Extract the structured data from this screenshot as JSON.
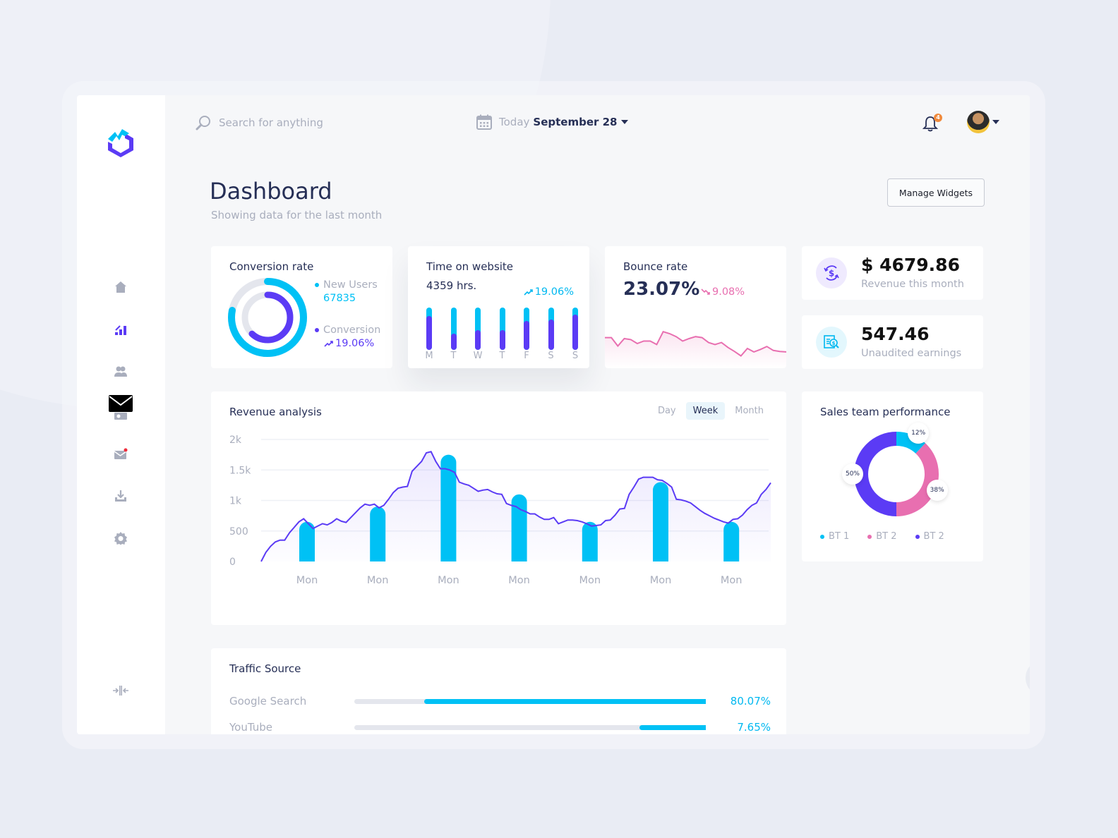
{
  "header": {
    "search_placeholder": "Search for anything",
    "date_prefix": "Today",
    "date_value": "September 28",
    "notification_count": "4"
  },
  "sidebar": {
    "items": [
      {
        "name": "home",
        "icon": "home-icon"
      },
      {
        "name": "analytics",
        "icon": "chart-icon",
        "active": true
      },
      {
        "name": "users",
        "icon": "users-icon"
      },
      {
        "name": "wallet",
        "icon": "wallet-icon"
      },
      {
        "name": "messages",
        "icon": "mail-icon",
        "has_notification": true
      },
      {
        "name": "downloads",
        "icon": "download-icon"
      },
      {
        "name": "settings",
        "icon": "gear-icon"
      }
    ],
    "collapse_icon": "collapse-icon"
  },
  "page": {
    "title": "Dashboard",
    "subtitle": "Showing data for the last month",
    "manage_widgets_label": "Manage Widgets"
  },
  "conversion": {
    "title": "Conversion rate",
    "new_users_label": "New Users",
    "new_users_value": "67835",
    "conversion_label": "Conversion",
    "conversion_value": "19.06%",
    "outer_ring_fraction": 0.78,
    "inner_ring_fraction": 0.62
  },
  "time_on_site": {
    "title": "Time on website",
    "value": "4359 hrs.",
    "change": "19.06%",
    "days": [
      "M",
      "T",
      "W",
      "T",
      "F",
      "S",
      "S"
    ],
    "fractions": [
      0.8,
      0.38,
      0.46,
      0.46,
      0.68,
      0.72,
      0.84
    ]
  },
  "bounce": {
    "title": "Bounce rate",
    "value": "23.07%",
    "change": "9.08%",
    "series": [
      62,
      62,
      45,
      60,
      58,
      50,
      55,
      55,
      48,
      74,
      70,
      64,
      55,
      60,
      64,
      62,
      52,
      48,
      52,
      42,
      34,
      25,
      40,
      33,
      38,
      44,
      36,
      34,
      33
    ]
  },
  "revenue_month": {
    "value": "$ 4679.86",
    "label": "Revenue this month"
  },
  "unaudited": {
    "value": "547.46",
    "label": "Unaudited earnings"
  },
  "colors": {
    "cyan": "#00c1f5",
    "purple": "#5b3bf5",
    "pink": "#e86fb0",
    "navy": "#262f56",
    "muted": "#a9aebd"
  },
  "chart_data": {
    "type": "bar",
    "title": "Revenue analysis",
    "tabs": [
      "Day",
      "Week",
      "Month"
    ],
    "active_tab": "Week",
    "categories": [
      "Mon",
      "Mon",
      "Mon",
      "Mon",
      "Mon",
      "Mon",
      "Mon"
    ],
    "yticks": [
      "0",
      "500",
      "1k",
      "1.5k",
      "2k"
    ],
    "ylim": [
      0,
      2000
    ],
    "bar_values": [
      650,
      900,
      1750,
      1100,
      650,
      1300,
      650
    ],
    "line_series": [
      0,
      150,
      250,
      320,
      350,
      350,
      470,
      560,
      650,
      700,
      620,
      540,
      580,
      620,
      600,
      640,
      700,
      660,
      640,
      720,
      800,
      880,
      940,
      920,
      940,
      880,
      920,
      1020,
      1130,
      1200,
      1220,
      1230,
      1480,
      1560,
      1640,
      1780,
      1800,
      1640,
      1520,
      1520,
      1500,
      1460,
      1300,
      1270,
      1250,
      1200,
      1150,
      1170,
      1180,
      1140,
      1110,
      1100,
      950,
      920,
      900,
      850,
      820,
      780,
      780,
      730,
      690,
      690,
      720,
      620,
      650,
      680,
      680,
      670,
      650,
      620,
      580,
      590,
      600,
      670,
      680,
      760,
      860,
      870,
      1100,
      1220,
      1350,
      1380,
      1380,
      1380,
      1340,
      1330,
      1280,
      1220,
      1020,
      1010,
      990,
      960,
      900,
      840,
      790,
      750,
      710,
      680,
      650,
      630,
      690,
      700,
      760,
      850,
      920,
      960,
      1100,
      1180,
      1290
    ]
  },
  "sales_team": {
    "title": "Sales team performance",
    "segments": [
      {
        "label": "BT 1",
        "value": 12,
        "display": "12%",
        "color": "#00c1f5"
      },
      {
        "label": "BT 2",
        "value": 38,
        "display": "38%",
        "color": "#e86fb0"
      },
      {
        "label": "BT 2",
        "value": 50,
        "display": "50%",
        "color": "#5b3bf5"
      }
    ]
  },
  "traffic": {
    "title": "Traffic Source",
    "rows": [
      {
        "label": "Google Search",
        "value": "80.07%",
        "fraction": 0.8007
      },
      {
        "label": "YouTube",
        "value": "7.65%",
        "fraction": 0.1893
      }
    ]
  }
}
